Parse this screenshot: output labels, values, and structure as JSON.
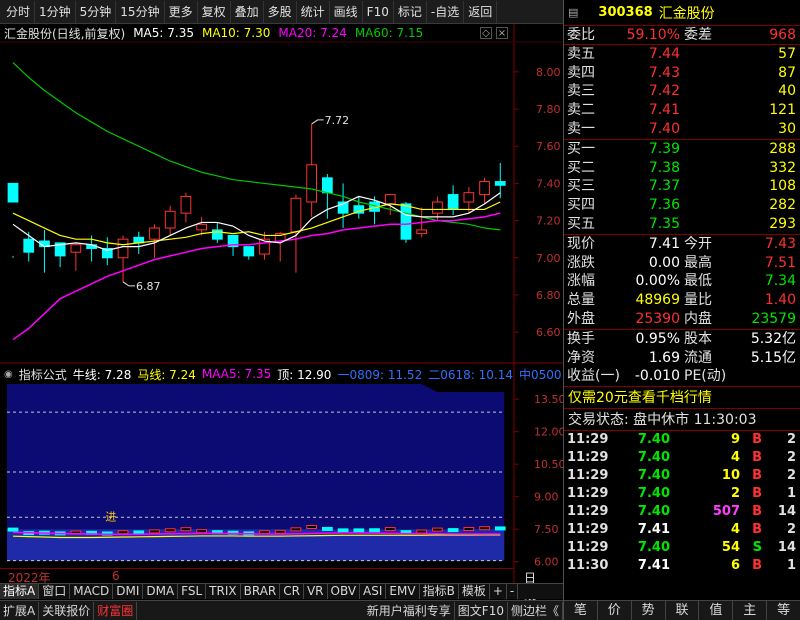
{
  "toolbar": {
    "items": [
      "分时",
      "1分钟",
      "5分钟",
      "15分钟",
      "更多",
      "复权",
      "叠加",
      "多股",
      "统计",
      "画线",
      "F10",
      "标记",
      "-自选",
      "返回"
    ]
  },
  "main_header": {
    "title": "汇金股份(日线,前复权)",
    "ma5": "MA5: 7.35",
    "ma10": "MA10: 7.30",
    "ma20": "MA20: 7.24",
    "ma60": "MA60: 7.15"
  },
  "sub_header": {
    "title": "指标公式",
    "niu": "牛线: 7.28",
    "ma": "马线: 7.24",
    "maa5": "MAA5: 7.35",
    "ding": "顶: 12.90",
    "l1": "一0809: 11.52",
    "l2": "二0618: 10.14",
    "l3": "中0500"
  },
  "annotations": {
    "high": "7.72",
    "low": "6.87",
    "jin": "进"
  },
  "colors": {
    "up": "#ff3232",
    "down": "#00ffff",
    "ma5": "#ffffff",
    "ma10": "#ffff00",
    "ma20": "#ff00ff",
    "ma60": "#00c800",
    "sub_bg": "#0b0b73",
    "axis": "#800000"
  },
  "chart_data": [
    {
      "type": "candlestick",
      "title": "汇金股份(日线,前复权)",
      "ylim": [
        6.45,
        8.15
      ],
      "y_ticks": [
        "8.00",
        "7.80",
        "7.60",
        "7.40",
        "7.20",
        "7.00",
        "6.80",
        "6.60"
      ],
      "y_tick_values": [
        8.0,
        7.8,
        7.6,
        7.4,
        7.2,
        7.0,
        6.8,
        6.6
      ],
      "candles": [
        [
          7.4,
          7.3,
          7.0,
          7.01,
          7.5
        ],
        [
          7.1,
          7.03,
          6.98,
          7.14,
          7.16
        ],
        [
          7.09,
          7.06,
          6.92,
          7.15,
          7.14
        ],
        [
          7.08,
          7.01,
          6.95,
          7.03,
          7.15
        ],
        [
          7.03,
          7.07,
          6.93,
          7.08,
          7.12
        ],
        [
          7.07,
          7.05,
          6.98,
          7.12,
          7.15
        ],
        [
          7.05,
          7.0,
          6.96,
          7.11,
          7.08
        ],
        [
          7.0,
          7.1,
          6.87,
          7.12,
          7.14
        ],
        [
          7.11,
          7.08,
          7.02,
          7.14,
          7.14
        ],
        [
          7.1,
          7.16,
          7.0,
          7.18,
          7.13
        ],
        [
          7.16,
          7.25,
          7.12,
          7.28,
          7.22
        ],
        [
          7.24,
          7.33,
          7.19,
          7.35,
          7.28
        ],
        [
          7.15,
          7.18,
          7.12,
          7.22,
          7.2
        ],
        [
          7.15,
          7.1,
          7.08,
          7.19,
          7.17
        ],
        [
          7.12,
          7.06,
          7.01,
          7.12,
          7.08
        ],
        [
          7.06,
          7.01,
          6.99,
          7.06,
          7.07
        ],
        [
          7.02,
          7.1,
          6.99,
          7.14,
          7.06
        ],
        [
          7.09,
          7.13,
          6.98,
          7.14,
          7.09
        ],
        [
          7.14,
          7.32,
          6.92,
          7.34,
          7.16
        ],
        [
          7.3,
          7.5,
          7.22,
          7.72,
          7.3
        ],
        [
          7.43,
          7.35,
          7.21,
          7.45,
          7.29
        ],
        [
          7.3,
          7.24,
          7.16,
          7.4,
          7.27
        ],
        [
          7.28,
          7.24,
          7.21,
          7.33,
          7.24
        ],
        [
          7.3,
          7.25,
          7.18,
          7.33,
          7.2
        ],
        [
          7.29,
          7.34,
          7.23,
          7.34,
          7.22
        ],
        [
          7.29,
          7.1,
          7.08,
          7.3,
          7.25
        ],
        [
          7.13,
          7.15,
          7.11,
          7.27,
          7.21
        ],
        [
          7.24,
          7.3,
          7.2,
          7.33,
          7.24
        ],
        [
          7.34,
          7.26,
          7.23,
          7.39,
          7.26
        ],
        [
          7.3,
          7.35,
          7.24,
          7.38,
          7.24
        ],
        [
          7.34,
          7.41,
          7.29,
          7.43,
          7.24
        ],
        [
          7.41,
          7.39,
          7.32,
          7.51,
          7.24
        ]
      ],
      "ma5": [
        7.18,
        7.12,
        7.06,
        7.07,
        7.08,
        7.07,
        7.04,
        7.06,
        7.06,
        7.08,
        7.12,
        7.16,
        7.19,
        7.19,
        7.17,
        7.12,
        7.09,
        7.08,
        7.12,
        7.21,
        7.26,
        7.29,
        7.33,
        7.31,
        7.28,
        7.23,
        7.22,
        7.22,
        7.22,
        7.24,
        7.29,
        7.35
      ],
      "ma10": [
        7.24,
        7.2,
        7.16,
        7.12,
        7.1,
        7.1,
        7.08,
        7.07,
        7.08,
        7.09,
        7.1,
        7.11,
        7.13,
        7.14,
        7.13,
        7.14,
        7.12,
        7.12,
        7.14,
        7.16,
        7.19,
        7.22,
        7.25,
        7.27,
        7.29,
        7.28,
        7.26,
        7.26,
        7.26,
        7.26,
        7.26,
        7.3
      ],
      "ma20": [
        6.56,
        6.62,
        6.7,
        6.78,
        6.82,
        6.86,
        6.9,
        6.93,
        6.96,
        6.99,
        7.01,
        7.03,
        7.05,
        7.06,
        7.07,
        7.07,
        7.08,
        7.09,
        7.1,
        7.12,
        7.13,
        7.15,
        7.16,
        7.17,
        7.18,
        7.18,
        7.19,
        7.2,
        7.2,
        7.21,
        7.22,
        7.24
      ],
      "ma60": [
        8.05,
        7.97,
        7.9,
        7.84,
        7.78,
        7.73,
        7.68,
        7.64,
        7.6,
        7.56,
        7.52,
        7.49,
        7.46,
        7.44,
        7.42,
        7.41,
        7.4,
        7.39,
        7.38,
        7.37,
        7.35,
        7.33,
        7.3,
        7.28,
        7.26,
        7.24,
        7.22,
        7.2,
        7.19,
        7.18,
        7.16,
        7.15
      ],
      "marker_high": {
        "index": 19,
        "value": 7.72
      },
      "marker_low": {
        "index": 7,
        "value": 6.87
      }
    },
    {
      "type": "area",
      "title": "指标公式",
      "ylim": [
        5.85,
        14.2
      ],
      "y_ticks": [
        "13.50",
        "12.00",
        "10.50",
        "9.00",
        "7.50",
        "6.00"
      ],
      "y_tick_values": [
        13.5,
        12.0,
        10.5,
        9.0,
        7.5,
        6.0
      ],
      "ding": 12.9,
      "l1": 11.52,
      "l2": 10.14,
      "l3": 5.0,
      "niu": [
        7.36,
        7.34,
        7.32,
        7.3,
        7.29,
        7.28,
        7.27,
        7.26,
        7.27,
        7.28,
        7.29,
        7.3,
        7.31,
        7.31,
        7.3,
        7.29,
        7.28,
        7.28,
        7.29,
        7.31,
        7.32,
        7.33,
        7.33,
        7.32,
        7.31,
        7.3,
        7.3,
        7.29,
        7.28,
        7.28,
        7.28,
        7.28
      ],
      "ma": [
        7.18,
        7.16,
        7.14,
        7.12,
        7.12,
        7.12,
        7.13,
        7.14,
        7.15,
        7.16,
        7.17,
        7.18,
        7.19,
        7.19,
        7.19,
        7.18,
        7.18,
        7.18,
        7.19,
        7.2,
        7.21,
        7.22,
        7.22,
        7.22,
        7.22,
        7.22,
        7.22,
        7.23,
        7.23,
        7.23,
        7.24,
        7.24
      ]
    }
  ],
  "year_row": {
    "year": "2022年",
    "month": "6"
  },
  "indicator_tabs": [
    "指标A",
    "窗口",
    "MACD",
    "DMI",
    "DMA",
    "FSL",
    "TRIX",
    "BRAR",
    "CR",
    "VR",
    "OBV",
    "ASI",
    "EMV",
    "指标B",
    "模板",
    "+",
    "-"
  ],
  "period_label": "日线",
  "bottom_tabs": [
    "扩展A",
    "关联报价",
    "财富圈"
  ],
  "bottom_right": [
    "新用户福利专享",
    "图文F10",
    "侧边栏《"
  ],
  "quote": {
    "code": "300368",
    "name": "汇金股份",
    "weibi_label": "委比",
    "weibi": "59.10%",
    "weicha_label": "委差",
    "weicha": "968",
    "sells": [
      {
        "label": "卖五",
        "price": "7.44",
        "vol": "57"
      },
      {
        "label": "卖四",
        "price": "7.43",
        "vol": "87"
      },
      {
        "label": "卖三",
        "price": "7.42",
        "vol": "40"
      },
      {
        "label": "卖二",
        "price": "7.41",
        "vol": "121"
      },
      {
        "label": "卖一",
        "price": "7.40",
        "vol": "30"
      }
    ],
    "buys": [
      {
        "label": "买一",
        "price": "7.39",
        "vol": "288"
      },
      {
        "label": "买二",
        "price": "7.38",
        "vol": "332"
      },
      {
        "label": "买三",
        "price": "7.37",
        "vol": "108"
      },
      {
        "label": "买四",
        "price": "7.36",
        "vol": "282"
      },
      {
        "label": "买五",
        "price": "7.35",
        "vol": "293"
      }
    ],
    "stats": [
      {
        "l1": "现价",
        "v1": "7.41",
        "l2": "今开",
        "v2": "7.43"
      },
      {
        "l1": "涨跌",
        "v1": "0.00",
        "l2": "最高",
        "v2": "7.51"
      },
      {
        "l1": "涨幅",
        "v1": "0.00%",
        "l2": "最低",
        "v2": "7.34"
      },
      {
        "l1": "总量",
        "v1": "48969",
        "l2": "量比",
        "v2": "1.40"
      },
      {
        "l1": "外盘",
        "v1": "25390",
        "l2": "内盘",
        "v2": "23579"
      }
    ],
    "stats2": [
      {
        "l1": "换手",
        "v1": "0.95%",
        "l2": "股本",
        "v2": "5.32亿"
      },
      {
        "l1": "净资",
        "v1": "1.69",
        "l2": "流通",
        "v2": "5.15亿"
      },
      {
        "l1": "收益(一)",
        "v1": "-0.010",
        "l2": "PE(动)",
        "v2": ""
      }
    ],
    "adv": "仅需20元查看千档行情",
    "trade_status": "交易状态: 盘中休市 11:30:03",
    "ticks": [
      {
        "t": "11:29",
        "p": "7.40",
        "v": "9",
        "s": "B",
        "n": "2"
      },
      {
        "t": "11:29",
        "p": "7.40",
        "v": "4",
        "s": "B",
        "n": "2"
      },
      {
        "t": "11:29",
        "p": "7.40",
        "v": "10",
        "s": "B",
        "n": "2"
      },
      {
        "t": "11:29",
        "p": "7.40",
        "v": "2",
        "s": "B",
        "n": "1"
      },
      {
        "t": "11:29",
        "p": "7.40",
        "v": "507",
        "s": "B",
        "n": "14"
      },
      {
        "t": "11:29",
        "p": "7.41",
        "v": "4",
        "s": "B",
        "n": "2"
      },
      {
        "t": "11:29",
        "p": "7.40",
        "v": "54",
        "s": "S",
        "n": "14"
      },
      {
        "t": "11:30",
        "p": "7.41",
        "v": "6",
        "s": "B",
        "n": "1"
      }
    ],
    "tabs": [
      "笔",
      "价",
      "势",
      "联",
      "值",
      "主",
      "等"
    ]
  }
}
